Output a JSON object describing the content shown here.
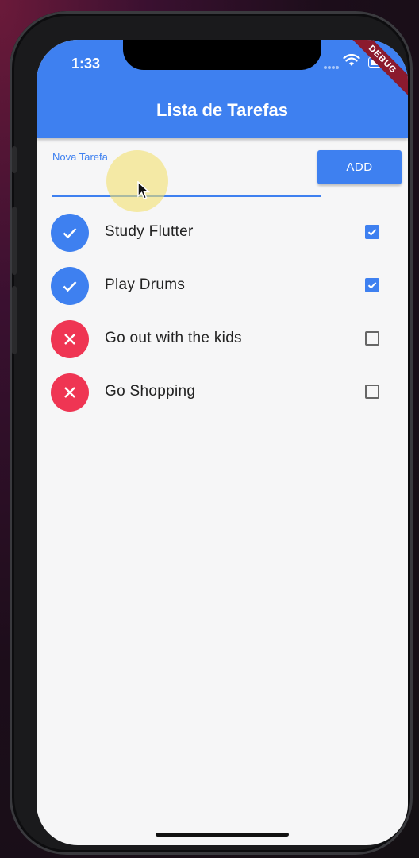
{
  "status": {
    "time": "1:33",
    "debug_banner": "DEBUG"
  },
  "appbar": {
    "title": "Lista de Tarefas"
  },
  "form": {
    "label": "Nova Tarefa",
    "value": "",
    "button_label": "ADD"
  },
  "tasks": [
    {
      "title": "Study Flutter",
      "done": true
    },
    {
      "title": "Play Drums",
      "done": true
    },
    {
      "title": "Go out with the kids",
      "done": false
    },
    {
      "title": "Go Shopping",
      "done": false
    }
  ],
  "colors": {
    "primary": "#3e80f0",
    "done": "#3e80f0",
    "pending": "#ef3553"
  },
  "icons": {
    "done": "check-icon",
    "pending": "close-icon"
  }
}
